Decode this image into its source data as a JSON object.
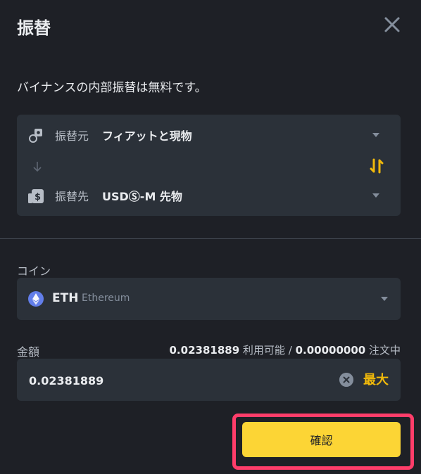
{
  "dialog": {
    "title": "振替",
    "intro": "バイナンスの内部振替は無料です。"
  },
  "transfer": {
    "from": {
      "label": "振替元",
      "value": "フィアットと現物",
      "icon": "wallet-icon"
    },
    "to": {
      "label": "振替先",
      "value": "USDⓈ-M 先物",
      "icon": "futures-icon"
    },
    "arrow_icon": "arrow-down-icon",
    "swap_icon": "swap-icon"
  },
  "coin": {
    "label": "コイン",
    "symbol": "ETH",
    "name": "Ethereum",
    "icon": "ethereum-icon"
  },
  "amount": {
    "label": "金額",
    "available_value": "0.02381889",
    "available_text": "利用可能",
    "separator": "/",
    "in_order_value": "0.00000000",
    "in_order_text": "注文中",
    "input_value": "0.02381889",
    "max_label": "最大"
  },
  "confirm_label": "確認",
  "colors": {
    "background": "#1e2026",
    "panel": "#2b3139",
    "accent": "#fcd535",
    "accent_text": "#f0b90b",
    "highlight": "#ff3d6a"
  }
}
